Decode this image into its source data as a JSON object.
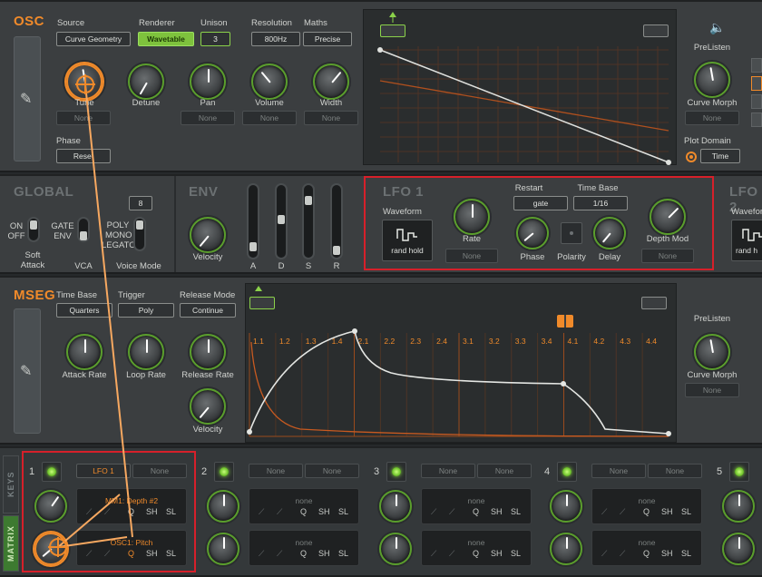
{
  "osc": {
    "title": "OSC",
    "source_label": "Source",
    "source_value": "Curve Geometry",
    "renderer_label": "Renderer",
    "renderer_value": "Wavetable",
    "unison_label": "Unison",
    "unison_value": "3",
    "resolution_label": "Resolution",
    "resolution_value": "800Hz",
    "maths_label": "Maths",
    "maths_value": "Precise",
    "knobs": [
      {
        "label": "Tune",
        "mod": "None"
      },
      {
        "label": "Detune",
        "mod": ""
      },
      {
        "label": "Pan",
        "mod": "None"
      },
      {
        "label": "Volume",
        "mod": "None"
      },
      {
        "label": "Width",
        "mod": "None"
      }
    ],
    "phase_label": "Phase",
    "phase_value": "Reset",
    "prelisten": "PreListen",
    "curve_morph_label": "Curve Morph",
    "curve_morph_mod": "None",
    "plot_domain_label": "Plot Domain",
    "plot_domain_value": "Time"
  },
  "global": {
    "title": "GLOBAL",
    "voices": "8",
    "on": "ON",
    "off": "OFF",
    "gate": "GATE",
    "env": "ENV",
    "poly": "POLY",
    "mono": "MONO",
    "legato": "LEGATO",
    "soft_attack": "Soft\nAttack",
    "vca": "VCA",
    "voice_mode": "Voice Mode"
  },
  "env": {
    "title": "ENV",
    "velocity": "Velocity",
    "sliders": [
      "A",
      "D",
      "S",
      "R"
    ],
    "levels": [
      0.1,
      0.55,
      0.85,
      0.05
    ]
  },
  "lfo1": {
    "title": "LFO 1",
    "waveform_label": "Waveform",
    "waveform_value": "rand hold",
    "rate_label": "Rate",
    "rate_mod": "None",
    "restart_label": "Restart",
    "restart_value": "gate",
    "timebase_label": "Time Base",
    "timebase_value": "1/16",
    "phase_label": "Phase",
    "polarity_label": "Polarity",
    "delay_label": "Delay",
    "depthmod_label": "Depth Mod",
    "depthmod_mod": "None"
  },
  "lfo2": {
    "title": "LFO 2",
    "waveform_label": "Wavefor",
    "waveform_value": "rand h"
  },
  "mseg": {
    "title": "MSEG",
    "timebase_label": "Time Base",
    "timebase_value": "Quarters",
    "trigger_label": "Trigger",
    "trigger_value": "Poly",
    "release_label": "Release Mode",
    "release_value": "Continue",
    "attack_rate": "Attack Rate",
    "loop_rate": "Loop Rate",
    "release_rate": "Release Rate",
    "velocity": "Velocity",
    "grid_labels": [
      "1.1",
      "1.2",
      "1.3",
      "1.4",
      "2.1",
      "2.2",
      "2.3",
      "2.4",
      "3.1",
      "3.2",
      "3.3",
      "3.4",
      "4.1",
      "4.2",
      "4.3",
      "4.4"
    ],
    "prelisten": "PreListen",
    "curve_morph_label": "Curve Morph",
    "curve_morph_mod": "None"
  },
  "matrix": {
    "tab_keys": "KEYS",
    "tab_matrix": "MATRIX",
    "slots": [
      {
        "num": "1",
        "src": "LFO 1",
        "via": "None",
        "dest1": "MM1: Depth #2",
        "dest2": "OSC1: Pitch"
      },
      {
        "num": "2",
        "src": "None",
        "via": "None",
        "dest1": "none",
        "dest2": "none"
      },
      {
        "num": "3",
        "src": "None",
        "via": "None",
        "dest1": "none",
        "dest2": "none"
      },
      {
        "num": "4",
        "src": "None",
        "via": "None",
        "dest1": "none",
        "dest2": "none"
      },
      {
        "num": "5",
        "src": "",
        "via": "",
        "dest1": "",
        "dest2": ""
      }
    ],
    "flags": [
      "Q",
      "SH",
      "SL"
    ]
  },
  "colors": {
    "accent": "#f08a2a",
    "led_green": "#8fe040",
    "highlight_red": "#d6202a"
  }
}
